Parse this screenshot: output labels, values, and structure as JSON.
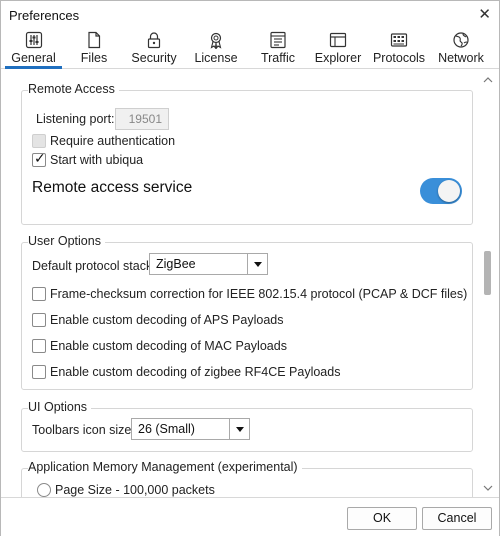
{
  "window": {
    "title": "Preferences",
    "close_glyph": "✕"
  },
  "tabs": [
    {
      "label": "General",
      "icon": "sliders-icon",
      "active": true
    },
    {
      "label": "Files",
      "icon": "file-icon",
      "active": false
    },
    {
      "label": "Security",
      "icon": "lock-icon",
      "active": false
    },
    {
      "label": "License",
      "icon": "award-icon",
      "active": false
    },
    {
      "label": "Traffic",
      "icon": "traffic-icon",
      "active": false
    },
    {
      "label": "Explorer",
      "icon": "window-icon",
      "active": false
    },
    {
      "label": "Protocols",
      "icon": "grid-icon",
      "active": false
    },
    {
      "label": "Network",
      "icon": "globe-icon",
      "active": false
    }
  ],
  "remote_access": {
    "title": "Remote Access",
    "listening_port_label": "Listening port:",
    "listening_port_value": "19501",
    "require_auth_label": "Require authentication",
    "require_auth_checked": false,
    "start_with_ubiqua_label": "Start with ubiqua",
    "start_with_ubiqua_checked": true,
    "service_label": "Remote access service",
    "service_on": true
  },
  "user_options": {
    "title": "User Options",
    "default_stack_label": "Default protocol stack:",
    "default_stack_value": "ZigBee",
    "fcs_label": "Frame-checksum correction for IEEE 802.15.4 protocol (PCAP & DCF files)",
    "aps_label": "Enable custom decoding of APS Payloads",
    "mac_label": "Enable custom decoding of MAC Payloads",
    "rf4ce_label": "Enable custom decoding of zigbee RF4CE Payloads"
  },
  "ui_options": {
    "title": "UI Options",
    "icon_size_label": "Toolbars icon size:",
    "icon_size_value": "26 (Small)"
  },
  "memory": {
    "title": "Application Memory Management (experimental)",
    "page_size_label": "Page Size - 100,000 packets"
  },
  "footer": {
    "ok_label": "OK",
    "cancel_label": "Cancel"
  },
  "colors": {
    "accent": "#3a8fd9",
    "tab_underline": "#1f6fbf"
  }
}
